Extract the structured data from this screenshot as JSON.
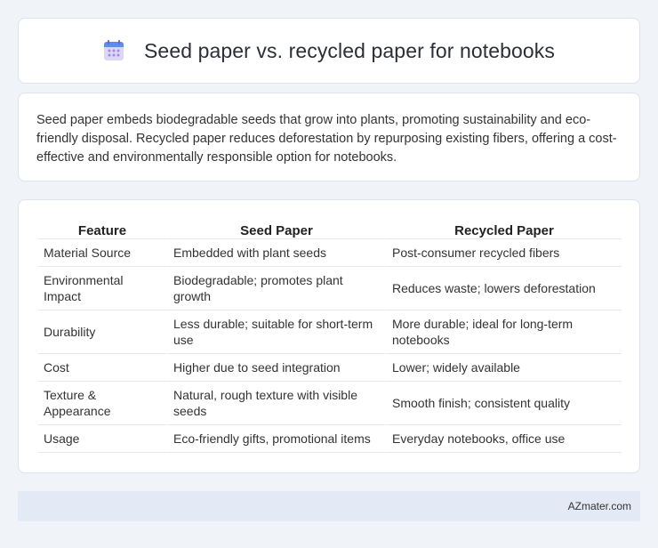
{
  "header": {
    "icon": "calendar-icon",
    "title": "Seed paper vs. recycled paper for notebooks"
  },
  "intro": {
    "text": "Seed paper embeds biodegradable seeds that grow into plants, promoting sustainability and eco-friendly disposal. Recycled paper reduces deforestation by repurposing existing fibers, offering a cost-effective and environmentally responsible option for notebooks."
  },
  "table": {
    "headers": [
      "Feature",
      "Seed Paper",
      "Recycled Paper"
    ],
    "rows": [
      [
        "Material Source",
        "Embedded with plant seeds",
        "Post-consumer recycled fibers"
      ],
      [
        "Environmental Impact",
        "Biodegradable; promotes plant growth",
        "Reduces waste; lowers deforestation"
      ],
      [
        "Durability",
        "Less durable; suitable for short-term use",
        "More durable; ideal for long-term notebooks"
      ],
      [
        "Cost",
        "Higher due to seed integration",
        "Lower; widely available"
      ],
      [
        "Texture & Appearance",
        "Natural, rough texture with visible seeds",
        "Smooth finish; consistent quality"
      ],
      [
        "Usage",
        "Eco-friendly gifts, promotional items",
        "Everyday notebooks, office use"
      ]
    ]
  },
  "footer": {
    "brand": "AZmater.com"
  },
  "colors": {
    "background": "#f0f3f8",
    "footer": "#e4eaf5",
    "icon_top": "#5b8def",
    "icon_body": "#dcd6f7",
    "icon_dots": "#a58be0"
  }
}
